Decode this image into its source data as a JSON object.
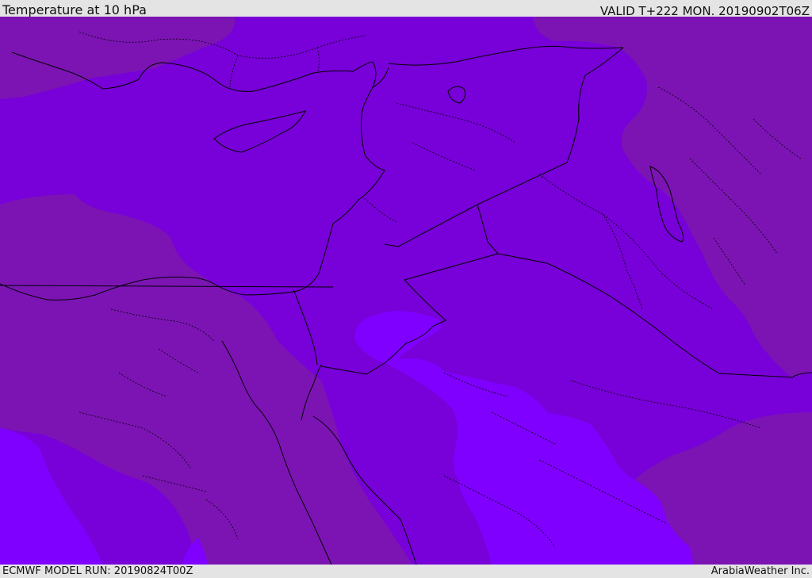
{
  "header": {
    "title": "Temperature at 10 hPa",
    "valid_time": "VALID T+222 MON. 20190902T06Z"
  },
  "footer": {
    "model_run": "ECMWF MODEL RUN: 20190824T00Z",
    "credit": "ArabiaWeather Inc."
  },
  "map": {
    "region": "Eastern Mediterranean / Middle East",
    "colors": {
      "base_field": "#7800d8",
      "cooler_zone": "#7c14b4",
      "warmer_zone": "#8000ff",
      "coastline": "#000000",
      "border": "#000000"
    }
  }
}
